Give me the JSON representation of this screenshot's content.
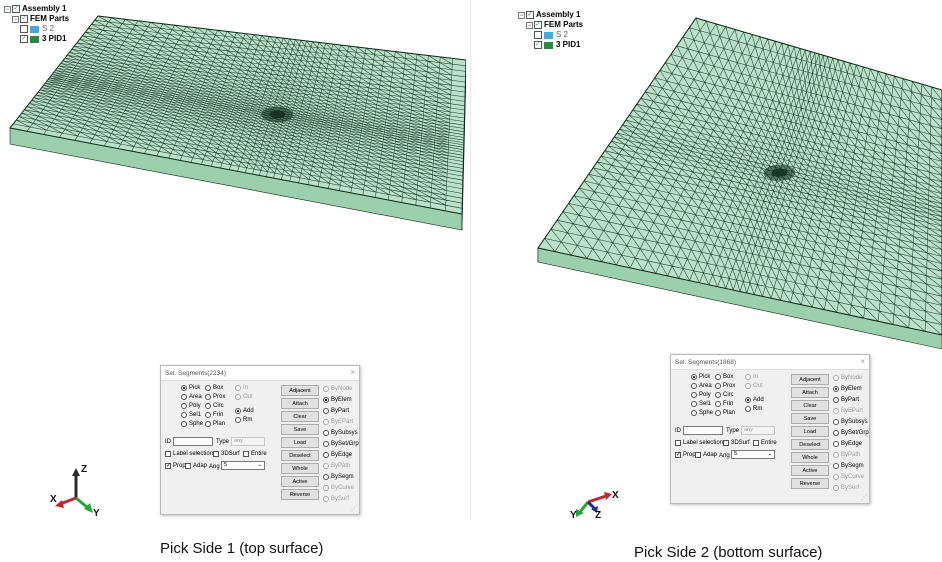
{
  "panels": [
    {
      "tree": {
        "assembly": "Assembly 1",
        "group": "FEM Parts",
        "items": [
          {
            "label": "S 2",
            "color": "#49a7e0",
            "checked": false
          },
          {
            "label": "3 PID1",
            "color": "#2b8a3e",
            "checked": true
          }
        ]
      },
      "dialog": {
        "title": "Sel. Segments(2234)",
        "close": "×",
        "methods_col1": [
          "Pick",
          "Area",
          "Poly",
          "Sel1",
          "Sphe"
        ],
        "methods_col2": [
          "Box",
          "Prox",
          "Circ",
          "Frin",
          "Plan"
        ],
        "inout": [
          "In",
          "Out"
        ],
        "addrm": [
          "Add",
          "Rm"
        ],
        "buttons": [
          "Adjacent",
          "Attach",
          "Clear",
          "Save",
          "Load",
          "Deselect",
          "Whole",
          "Active",
          "Reverse"
        ],
        "by_options": [
          "ByNode",
          "ByElem",
          "ByPart",
          "ByEPart",
          "BySubsys",
          "BySet/Grp",
          "ByEdge",
          "ByPath",
          "BySegm",
          "ByCurve",
          "BySurf"
        ],
        "id_label": "ID",
        "type_label": "Type",
        "type_value": "any",
        "label_selection": "Label selection",
        "surf3d": "3DSurf",
        "entire": "Entire",
        "prop": "Prop",
        "adap": "Adap",
        "ang_label": "Ang",
        "ang_value": "5"
      },
      "axes": [
        "Z",
        "X",
        "Y"
      ],
      "caption": "Pick Side 1 (top surface)"
    },
    {
      "tree": {
        "assembly": "Assembly 1",
        "group": "FEM Parts",
        "items": [
          {
            "label": "S 2",
            "color": "#49a7e0",
            "checked": false
          },
          {
            "label": "3 PID1",
            "color": "#2b8a3e",
            "checked": true
          }
        ]
      },
      "dialog": {
        "title": "Sel. Segments(1868)",
        "close": "×",
        "methods_col1": [
          "Pick",
          "Area",
          "Poly",
          "Sel1",
          "Sphe"
        ],
        "methods_col2": [
          "Box",
          "Prox",
          "Circ",
          "Frin",
          "Plan"
        ],
        "inout": [
          "In",
          "Out"
        ],
        "addrm": [
          "Add",
          "Rm"
        ],
        "buttons": [
          "Adjacent",
          "Attach",
          "Clear",
          "Save",
          "Load",
          "Deselect",
          "Whole",
          "Active",
          "Reverse"
        ],
        "by_options": [
          "ByNode",
          "ByElem",
          "ByPart",
          "ByEPart",
          "BySubsys",
          "BySet/Grp",
          "ByEdge",
          "ByPath",
          "BySegm",
          "ByCurve",
          "BySurf"
        ],
        "id_label": "ID",
        "type_label": "Type",
        "type_value": "any",
        "label_selection": "Label selection",
        "surf3d": "3DSurf",
        "entire": "Entire",
        "prop": "Prop",
        "adap": "Adap",
        "ang_label": "Ang",
        "ang_value": "5"
      },
      "axes": [
        "Z",
        "X",
        "Y"
      ],
      "caption": "Pick Side 2 (bottom surface)"
    }
  ],
  "colors": {
    "mesh_line": "#0f2a1a",
    "mesh_fill": "#b9e3c8",
    "axis_z": "#2a2a2a",
    "axis_x": "#c0272d",
    "axis_y": "#2aa33a"
  }
}
